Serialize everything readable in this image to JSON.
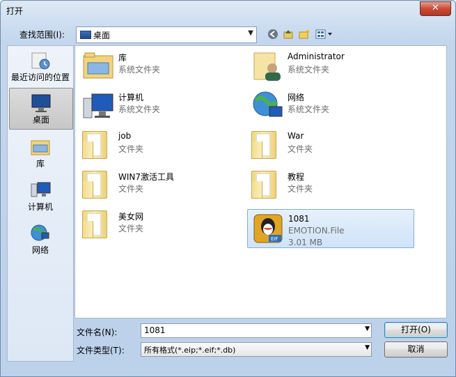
{
  "window": {
    "title": "打开",
    "close_label": "✕"
  },
  "lookin": {
    "label": "查找范围(I):",
    "value": "桌面"
  },
  "places": [
    {
      "label": "最近访问的位置"
    },
    {
      "label": "桌面"
    },
    {
      "label": "库"
    },
    {
      "label": "计算机"
    },
    {
      "label": "网络"
    }
  ],
  "items": [
    {
      "name": "库",
      "type": "系统文件夹"
    },
    {
      "name": "Administrator",
      "type": "系统文件夹"
    },
    {
      "name": "计算机",
      "type": "系统文件夹"
    },
    {
      "name": "网络",
      "type": "系统文件夹"
    },
    {
      "name": "job",
      "type": "文件夹"
    },
    {
      "name": "War",
      "type": "文件夹"
    },
    {
      "name": "WIN7激活工具",
      "type": "文件夹"
    },
    {
      "name": "教程",
      "type": "文件夹"
    },
    {
      "name": "美女网",
      "type": "文件夹"
    },
    {
      "name": "1081",
      "type": "EMOTION.File",
      "size": "3.01 MB"
    }
  ],
  "filename": {
    "label": "文件名(N):",
    "value": "1081"
  },
  "filetype": {
    "label": "文件类型(T):",
    "value": "所有格式(*.eip;*.eif;*.db)"
  },
  "buttons": {
    "open": "打开(O)",
    "cancel": "取消"
  }
}
